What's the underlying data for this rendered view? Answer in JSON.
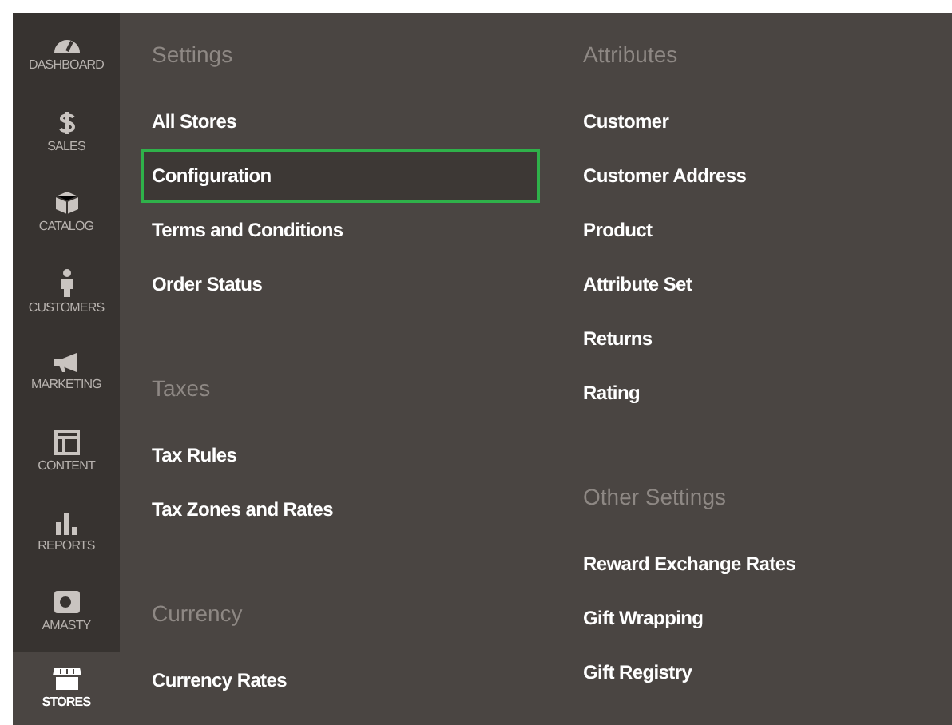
{
  "sidebar": {
    "items": [
      {
        "label": "DASHBOARD",
        "selected": false
      },
      {
        "label": "SALES",
        "selected": false
      },
      {
        "label": "CATALOG",
        "selected": false
      },
      {
        "label": "CUSTOMERS",
        "selected": false
      },
      {
        "label": "MARKETING",
        "selected": false
      },
      {
        "label": "CONTENT",
        "selected": false
      },
      {
        "label": "REPORTS",
        "selected": false
      },
      {
        "label": "AMASTY",
        "selected": false
      },
      {
        "label": "STORES",
        "selected": true
      }
    ]
  },
  "columns": [
    {
      "sections": [
        {
          "heading": "Settings",
          "items": [
            {
              "label": "All Stores",
              "selected": false
            },
            {
              "label": "Configuration",
              "selected": true
            },
            {
              "label": "Terms and Conditions",
              "selected": false
            },
            {
              "label": "Order Status",
              "selected": false
            }
          ]
        },
        {
          "heading": "Taxes",
          "items": [
            {
              "label": "Tax Rules",
              "selected": false
            },
            {
              "label": "Tax Zones and Rates",
              "selected": false
            }
          ]
        },
        {
          "heading": "Currency",
          "items": [
            {
              "label": "Currency Rates",
              "selected": false
            }
          ]
        }
      ]
    },
    {
      "sections": [
        {
          "heading": "Attributes",
          "items": [
            {
              "label": "Customer",
              "selected": false
            },
            {
              "label": "Customer Address",
              "selected": false
            },
            {
              "label": "Product",
              "selected": false
            },
            {
              "label": "Attribute Set",
              "selected": false
            },
            {
              "label": "Returns",
              "selected": false
            },
            {
              "label": "Rating",
              "selected": false
            }
          ]
        },
        {
          "heading": "Other Settings",
          "items": [
            {
              "label": "Reward Exchange Rates",
              "selected": false
            },
            {
              "label": "Gift Wrapping",
              "selected": false
            },
            {
              "label": "Gift Registry",
              "selected": false
            }
          ]
        }
      ]
    }
  ]
}
